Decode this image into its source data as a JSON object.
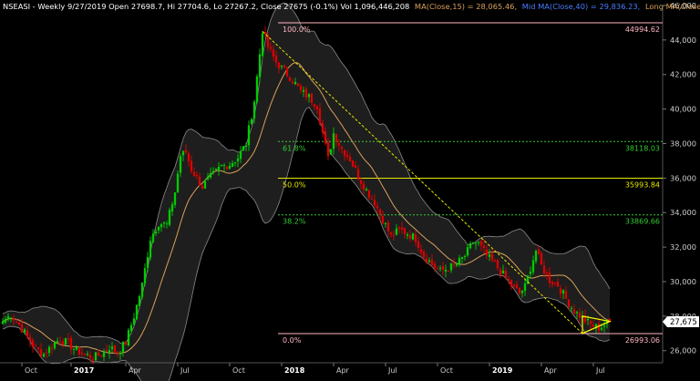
{
  "header": {
    "symbol_info": "NSEASI - Weekly 9/27/2019 Open 27698.7, Hi 27704.6, Lo 27267.2, Close 27675 (-0.1%) Vol 1,096,446,208",
    "ma15_text": "MA(Close,15) = 28,065.46,",
    "ma40_text": "Mid MA(Close,40) = 29,836.23,",
    "ma100_text": "Long MA(Close,100) = 34,"
  },
  "colors": {
    "background": "#000000",
    "up": "#00cc00",
    "down": "#dd0000",
    "ma": "#d9a05b",
    "band": "#8a8a8a",
    "fib_top": "#ffb6c1",
    "fib_618": "#33cc33",
    "fib_50": "#e6e600",
    "fib_382": "#33cc33",
    "fib_zero": "#ffb6c1",
    "trend": "#e6e600",
    "triangle": "#ffff00",
    "axis_text": "#cccccc",
    "last_box_bg": "#ffffff"
  },
  "chart_data": {
    "type": "candlestick",
    "yrange": [
      25300,
      46000
    ],
    "yticks": [
      26000,
      28000,
      30000,
      32000,
      34000,
      36000,
      38000,
      40000,
      42000,
      44000,
      46000
    ],
    "ytick_labels": [
      "26,000",
      "28,000",
      "30,000",
      "32,000",
      "34,000",
      "36,000",
      "38,000",
      "40,000",
      "42,000",
      "44,000",
      "46,000"
    ],
    "xticks": [
      "Oct",
      "2017",
      "Apr",
      "Jul",
      "Oct",
      "2018",
      "Apr",
      "Jul",
      "Oct",
      "2019",
      "Apr",
      "Jul"
    ],
    "bold_xticks": [
      "2017",
      "2018",
      "2019"
    ],
    "last_close": 27675,
    "last_close_label": "27,675",
    "fib_levels": [
      {
        "name": "top",
        "pct": "100.0%",
        "value": 44994.62,
        "value_label": "44994.62",
        "color_key": "fib_top"
      },
      {
        "name": "618",
        "pct": "61.8%",
        "value": 38118.03,
        "value_label": "38118.03",
        "color_key": "fib_618"
      },
      {
        "name": "50",
        "pct": "50.0%",
        "value": 35993.84,
        "value_label": "35993.84",
        "color_key": "fib_50"
      },
      {
        "name": "382",
        "pct": "38.2%",
        "value": 33869.66,
        "value_label": "33869.66",
        "color_key": "fib_382"
      },
      {
        "name": "zero",
        "pct": "0.0%",
        "value": 26993.06,
        "value_label": "26993.06",
        "color_key": "fib_zero"
      }
    ],
    "close_anchors": [
      [
        0,
        27700
      ],
      [
        3,
        28100
      ],
      [
        6,
        27500
      ],
      [
        9,
        26800
      ],
      [
        12,
        26100
      ],
      [
        15,
        25800
      ],
      [
        18,
        26300
      ],
      [
        21,
        26700
      ],
      [
        24,
        26400
      ],
      [
        27,
        26000
      ],
      [
        30,
        25800
      ],
      [
        33,
        25600
      ],
      [
        36,
        25800
      ],
      [
        39,
        26200
      ],
      [
        42,
        25900
      ],
      [
        45,
        26500
      ],
      [
        48,
        28000
      ],
      [
        51,
        29800
      ],
      [
        54,
        32500
      ],
      [
        57,
        33400
      ],
      [
        60,
        33300
      ],
      [
        63,
        35200
      ],
      [
        65,
        37300
      ],
      [
        67,
        37500
      ],
      [
        69,
        36500
      ],
      [
        71,
        36000
      ],
      [
        73,
        35500
      ],
      [
        75,
        35900
      ],
      [
        77,
        36200
      ],
      [
        80,
        36700
      ],
      [
        83,
        36800
      ],
      [
        86,
        37200
      ],
      [
        89,
        38000
      ],
      [
        92,
        40500
      ],
      [
        94,
        43200
      ],
      [
        95,
        44600
      ],
      [
        97,
        43600
      ],
      [
        100,
        42700
      ],
      [
        103,
        42200
      ],
      [
        106,
        41700
      ],
      [
        109,
        41000
      ],
      [
        112,
        40700
      ],
      [
        115,
        40200
      ],
      [
        117,
        38600
      ],
      [
        119,
        37100
      ],
      [
        121,
        38600
      ],
      [
        124,
        37700
      ],
      [
        127,
        37100
      ],
      [
        130,
        36100
      ],
      [
        133,
        35300
      ],
      [
        136,
        34600
      ],
      [
        139,
        33600
      ],
      [
        142,
        32600
      ],
      [
        145,
        33000
      ],
      [
        148,
        32800
      ],
      [
        151,
        32500
      ],
      [
        154,
        31500
      ],
      [
        157,
        31000
      ],
      [
        160,
        30600
      ],
      [
        163,
        30800
      ],
      [
        166,
        31000
      ],
      [
        169,
        31500
      ],
      [
        172,
        32300
      ],
      [
        174,
        32200
      ],
      [
        177,
        31500
      ],
      [
        180,
        31000
      ],
      [
        183,
        30400
      ],
      [
        186,
        29800
      ],
      [
        189,
        29300
      ],
      [
        191,
        29700
      ],
      [
        193,
        30800
      ],
      [
        195,
        31800
      ],
      [
        197,
        30900
      ],
      [
        200,
        30100
      ],
      [
        203,
        29800
      ],
      [
        206,
        29000
      ],
      [
        209,
        28300
      ],
      [
        212,
        27900
      ],
      [
        215,
        27500
      ],
      [
        218,
        27300
      ],
      [
        220,
        27500
      ],
      [
        222,
        27675
      ]
    ],
    "trend_line": [
      [
        95,
        44500
      ],
      [
        212,
        27000
      ]
    ],
    "triangle": [
      [
        212,
        27000
      ],
      [
        222,
        27700
      ],
      [
        212,
        28000
      ]
    ]
  }
}
